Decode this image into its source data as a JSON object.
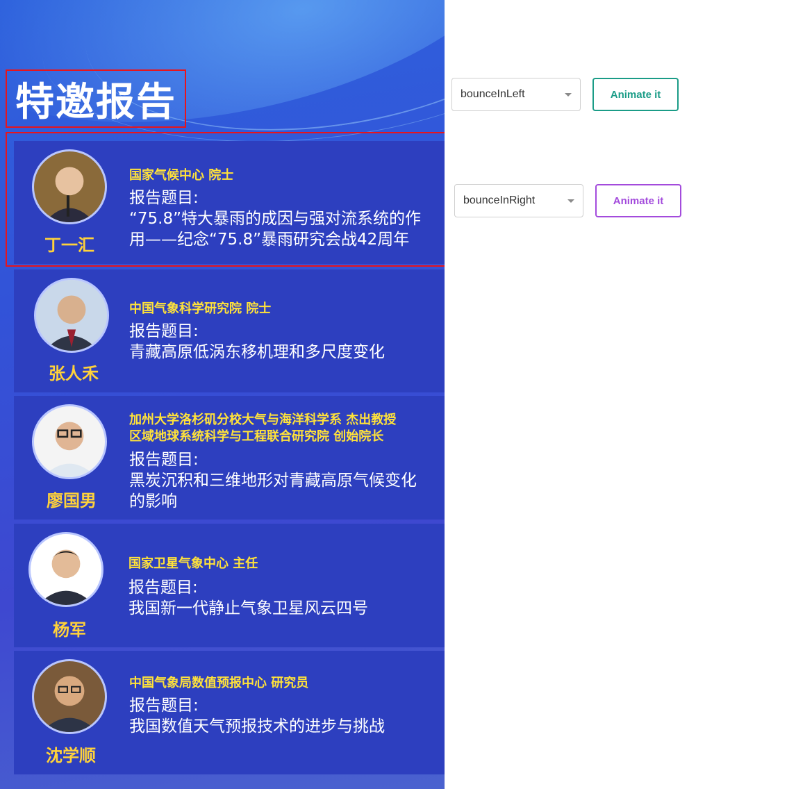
{
  "poster": {
    "title": "特邀报告",
    "report_label": "报告题目:",
    "speakers": [
      {
        "name": "丁一汇",
        "affiliation_lines": [
          "国家气候中心  院士"
        ],
        "topic_lines": [
          "“75.8”特大暴雨的成因与强对流系统的作",
          "用——纪念“75.8”暴雨研究会战42周年"
        ]
      },
      {
        "name": "张人禾",
        "affiliation_lines": [
          "中国气象科学研究院  院士"
        ],
        "topic_lines": [
          "青藏高原低涡东移机理和多尺度变化"
        ]
      },
      {
        "name": "廖国男",
        "affiliation_lines": [
          "加州大学洛杉矶分校大气与海洋科学系  杰出教授",
          "区域地球系统科学与工程联合研究院  创始院长"
        ],
        "topic_lines": [
          "黑炭沉积和三维地形对青藏高原气候变化",
          "的影响"
        ]
      },
      {
        "name": "杨军",
        "affiliation_lines": [
          "国家卫星气象中心   主任"
        ],
        "topic_lines": [
          "我国新一代静止气象卫星风云四号"
        ]
      },
      {
        "name": "沈学顺",
        "affiliation_lines": [
          "中国气象局数值预报中心  研究员"
        ],
        "topic_lines": [
          "我国数值天气预报技术的进步与挑战"
        ]
      }
    ]
  },
  "controls": {
    "row1": {
      "select_value": "bounceInLeft",
      "button_label": "Animate it",
      "button_color": "#1a9c87"
    },
    "row2": {
      "select_value": "bounceInRight",
      "button_label": "Animate it",
      "button_color": "#a34bdc"
    }
  },
  "colors": {
    "poster_bg": "#3253d8",
    "card_bg": "#2d3fbf",
    "name_color": "#ffd23a",
    "highlight_border": "#e8141c"
  }
}
